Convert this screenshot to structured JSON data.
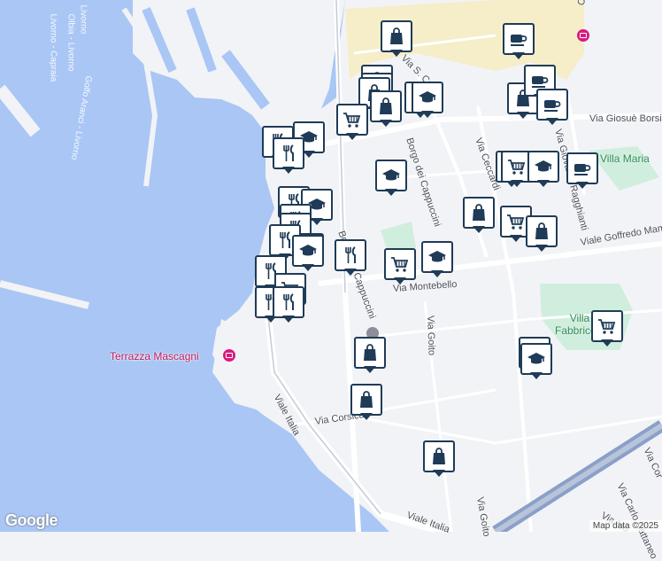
{
  "map": {
    "colors": {
      "water": "#a9c6f5",
      "land": "#f2f3f6",
      "road": "#ffffff",
      "park": "#cfeedd",
      "beige": "#f6edc9",
      "pin_border": "#1f3b57"
    },
    "roads": [
      {
        "text": "Via S. Carlo",
        "kind": "road"
      },
      {
        "text": "Borgo dei Cappuccini",
        "kind": "road"
      },
      {
        "text": "Via Ceccardi",
        "kind": "road"
      },
      {
        "text": "Via Giovanni Ragghianti",
        "kind": "road"
      },
      {
        "text": "Via Giosuè Borsi",
        "kind": "road"
      },
      {
        "text": "Viale Goffredo Mameli",
        "kind": "road"
      },
      {
        "text": "Via Montebello",
        "kind": "road"
      },
      {
        "text": "Via Goito",
        "kind": "road"
      },
      {
        "text": "Via Goito",
        "kind": "road"
      },
      {
        "text": "Borgo dei Cappuccini",
        "kind": "road"
      },
      {
        "text": "Viale Italia",
        "kind": "road"
      },
      {
        "text": "Via Corsica",
        "kind": "road"
      },
      {
        "text": "Viale Italia",
        "kind": "road"
      },
      {
        "text": "Via Carlo Cattaneo",
        "kind": "road"
      },
      {
        "text": "Via Cor",
        "kind": "road"
      },
      {
        "text": "Via Mo",
        "kind": "road"
      }
    ],
    "water_labels": [
      "Livorno - Capraia",
      "Olbia - Livorno",
      "Golfo Aranci - Livorno",
      "Livorno",
      "Co"
    ],
    "parks": [
      "Villa Maria",
      "Villa Fabbricotti"
    ],
    "places": [
      "Terrazza Mascagni"
    ],
    "pins": [
      {
        "icon": "bag"
      },
      {
        "icon": "cup"
      },
      {
        "icon": "bag"
      },
      {
        "icon": "grad"
      },
      {
        "icon": "bag"
      },
      {
        "icon": "cart"
      },
      {
        "icon": "grad"
      },
      {
        "icon": "bag"
      },
      {
        "icon": "cart"
      },
      {
        "icon": "bag"
      },
      {
        "icon": "cup"
      },
      {
        "icon": "cup"
      },
      {
        "icon": "fork"
      },
      {
        "icon": "grad"
      },
      {
        "icon": "fork"
      },
      {
        "icon": "cart"
      },
      {
        "icon": "cart"
      },
      {
        "icon": "grad"
      },
      {
        "icon": "cup"
      },
      {
        "icon": "grad"
      },
      {
        "icon": "fork"
      },
      {
        "icon": "grad"
      },
      {
        "icon": "fork"
      },
      {
        "icon": "fork"
      },
      {
        "icon": "grad"
      },
      {
        "icon": "bag"
      },
      {
        "icon": "cart"
      },
      {
        "icon": "bag"
      },
      {
        "icon": "fork"
      },
      {
        "icon": "fork"
      },
      {
        "icon": "grad"
      },
      {
        "icon": "fork"
      },
      {
        "icon": "cart"
      },
      {
        "icon": "grad"
      },
      {
        "icon": "fork"
      },
      {
        "icon": "cart"
      },
      {
        "icon": "fork"
      },
      {
        "icon": "cart"
      },
      {
        "icon": "grad"
      },
      {
        "icon": "grad"
      },
      {
        "icon": "bag"
      },
      {
        "icon": "bag"
      },
      {
        "icon": "bag"
      }
    ],
    "logo": "Google",
    "attribution": "Map data ©2025"
  }
}
